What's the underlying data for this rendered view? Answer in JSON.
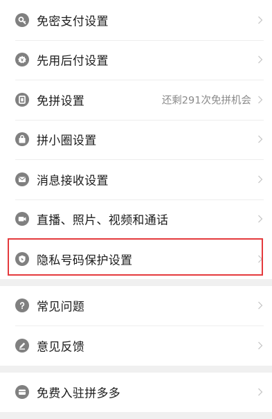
{
  "settings_group_1": {
    "items": [
      {
        "label": "免密支付设置",
        "icon": "key-icon",
        "value": ""
      },
      {
        "label": "先用后付设置",
        "icon": "pay-later-icon",
        "value": ""
      },
      {
        "label": "免拼设置",
        "icon": "coupon-icon",
        "value": "还剩291次免拼机会"
      },
      {
        "label": "拼小圈设置",
        "icon": "bag-icon",
        "value": ""
      },
      {
        "label": "消息接收设置",
        "icon": "mail-icon",
        "value": ""
      },
      {
        "label": "直播、照片、视频和通话",
        "icon": "video-camera-icon",
        "value": ""
      },
      {
        "label": "隐私号码保护设置",
        "icon": "shield-icon",
        "value": ""
      }
    ]
  },
  "settings_group_2": {
    "items": [
      {
        "label": "常见问题",
        "icon": "question-icon"
      },
      {
        "label": "意见反馈",
        "icon": "pen-icon"
      }
    ]
  },
  "settings_group_3": {
    "items": [
      {
        "label": "免费入驻拼多多",
        "icon": "store-icon"
      }
    ]
  },
  "highlight": {
    "color": "#e4393c",
    "target": "隐私号码保护设置"
  },
  "colors": {
    "icon": "#808080",
    "text": "#1c1c1c",
    "muted": "#8a8a8a",
    "separator": "#f0f0f0"
  }
}
